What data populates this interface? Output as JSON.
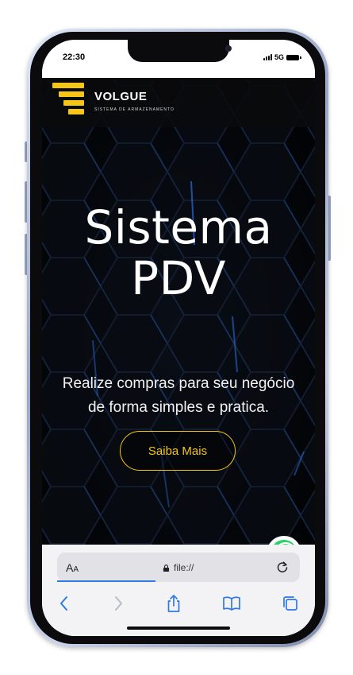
{
  "status_bar": {
    "time": "22:30",
    "network": "5G",
    "signal_icon": "signal-bars-icon",
    "battery_icon": "battery-icon"
  },
  "brand": {
    "name": "VOLGUE",
    "tagline": "SISTEMA DE ARMAZENAMENTO",
    "accent_color": "#f5c518"
  },
  "hero": {
    "title_line1": "Sistema",
    "title_line2": "PDV",
    "subtitle_line1": "Realize compras para seu negócio",
    "subtitle_line2": "de forma simples e pratica.",
    "cta_label": "Saiba Mais"
  },
  "floating": {
    "icon": "whatsapp-icon",
    "color": "#25d366"
  },
  "browser": {
    "text_size_label_big": "A",
    "text_size_label_small": "A",
    "url": "file://",
    "lock_icon": "lock-icon",
    "reload_icon": "reload-icon",
    "link_color": "#2f7ae5",
    "toolbar": [
      "back-icon",
      "forward-icon",
      "share-icon",
      "bookmarks-icon",
      "tabs-icon"
    ]
  }
}
